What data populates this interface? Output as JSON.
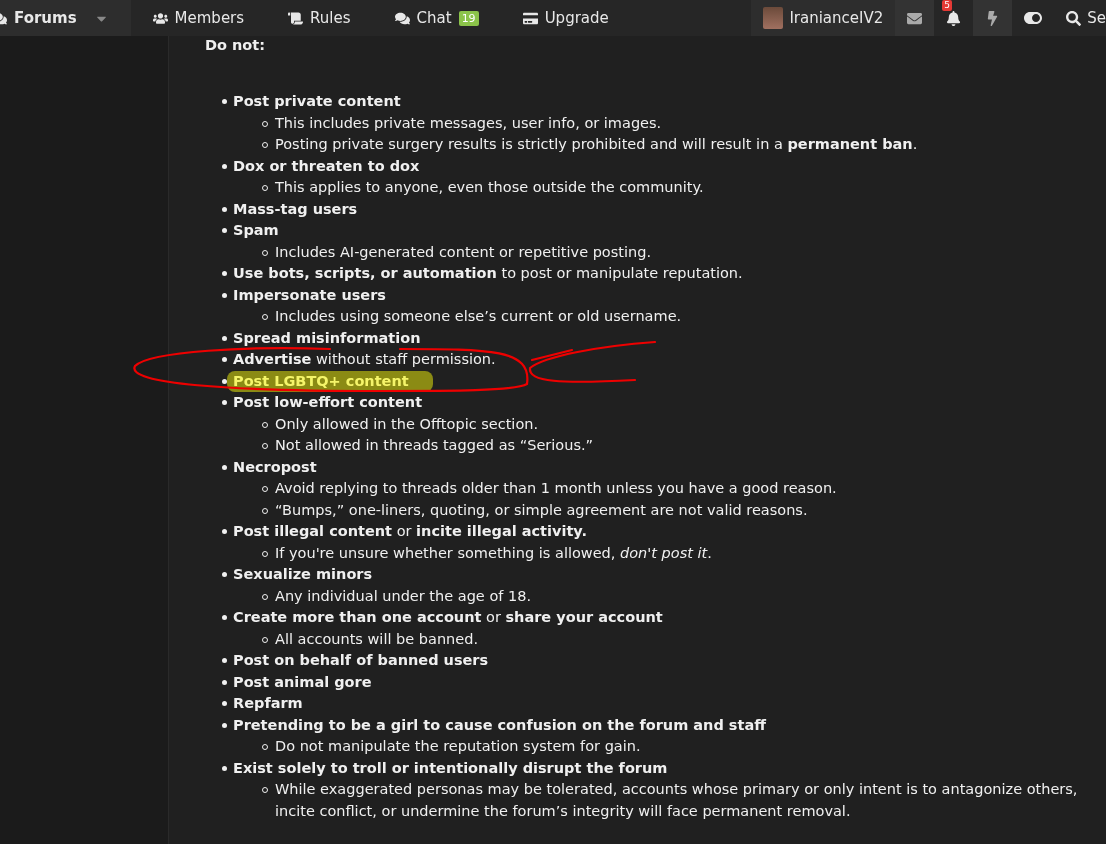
{
  "nav": {
    "tabs": [
      {
        "label": "Forums",
        "selected": true,
        "dropdown": true
      },
      {
        "label": "Members",
        "selected": false
      },
      {
        "label": "Rules",
        "selected": false
      },
      {
        "label": "Chat",
        "selected": false,
        "badge": "19"
      },
      {
        "label": "Upgrade",
        "selected": false
      }
    ],
    "user": {
      "name": "IranianceIV2"
    },
    "alerts_badge": "5",
    "search_label": "Se"
  },
  "heading": "Do not:",
  "rules": [
    {
      "kind": "bold",
      "text": "Post private content",
      "highlighted": false,
      "children": [
        "This includes private messages, user info, or images.",
        "Posting private surgery results is strictly prohibited and will result in a **permanent ban**."
      ]
    },
    {
      "kind": "bold",
      "text": "Dox or threaten to dox",
      "highlighted": false,
      "children": [
        "This applies to anyone, even those outside the community."
      ]
    },
    {
      "kind": "bold",
      "text": "Mass-tag users",
      "highlighted": false
    },
    {
      "kind": "bold",
      "text": "Spam",
      "highlighted": false,
      "children": [
        "Includes AI-generated content or repetitive posting."
      ]
    },
    {
      "kind": "mixed",
      "text": "**Use bots, scripts, or automation** to post or manipulate reputation.",
      "highlighted": false
    },
    {
      "kind": "bold",
      "text": "Impersonate users",
      "highlighted": false,
      "children": [
        "Includes using someone else’s current or old username."
      ]
    },
    {
      "kind": "bold",
      "text": "Spread misinformation",
      "highlighted": false
    },
    {
      "kind": "mixed",
      "text": "**Advertise** without staff permission.",
      "highlighted": false
    },
    {
      "kind": "bold",
      "text": "Post LGBTQ+ content",
      "highlighted": true
    },
    {
      "kind": "bold",
      "text": "Post low-effort content",
      "highlighted": false,
      "children": [
        "Only allowed in the Offtopic section.",
        "Not allowed in threads tagged as “Serious.”"
      ]
    },
    {
      "kind": "bold",
      "text": "Necropost",
      "highlighted": false,
      "children": [
        "Avoid replying to threads older than 1 month unless you have a good reason.",
        "“Bumps,” one-liners, quoting, or simple agreement are not valid reasons."
      ]
    },
    {
      "kind": "mixed",
      "text": "**Post illegal content** or **incite illegal activity.**",
      "highlighted": false,
      "children": [
        "If you're unsure whether something is allowed, *don't post it*."
      ]
    },
    {
      "kind": "bold",
      "text": "Sexualize minors",
      "highlighted": false,
      "children": [
        "Any individual under the age of 18."
      ]
    },
    {
      "kind": "mixed",
      "text": "**Create more than one account** or **share your account**",
      "highlighted": false,
      "children": [
        "All accounts will be banned."
      ]
    },
    {
      "kind": "bold",
      "text": "Post on behalf of banned users",
      "highlighted": false
    },
    {
      "kind": "bold",
      "text": "Post animal gore",
      "highlighted": false
    },
    {
      "kind": "bold",
      "text": "Repfarm",
      "highlighted": false
    },
    {
      "kind": "bold",
      "text": "Pretending to be a girl to cause confusion on the forum and staff",
      "highlighted": false,
      "children": [
        "Do not manipulate the reputation system for gain."
      ]
    },
    {
      "kind": "bold",
      "text": "Exist solely to troll or intentionally disrupt the forum",
      "highlighted": false,
      "children": [
        "While exaggerated personas may be tolerated, accounts whose primary or only intent is to antagonize others, incite conflict, or undermine the forum’s integrity will face permanent removal."
      ]
    }
  ]
}
